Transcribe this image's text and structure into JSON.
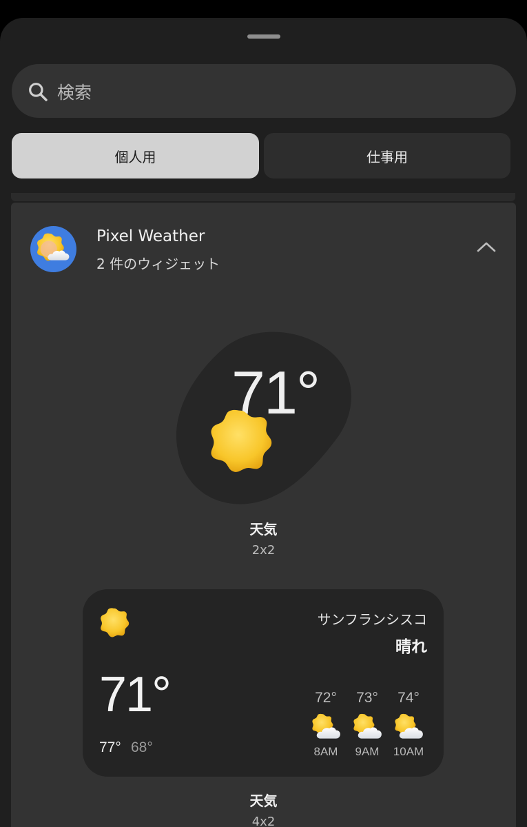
{
  "search": {
    "placeholder": "検索"
  },
  "tabs": [
    {
      "label": "個人用",
      "selected": true
    },
    {
      "label": "仕事用",
      "selected": false
    }
  ],
  "app": {
    "name": "Pixel Weather",
    "widget_count": "2 件のウィジェット",
    "icon": "weather-app-icon"
  },
  "widget_small": {
    "temperature": "71°",
    "label": "天気",
    "size": "2x2",
    "icon": "sun-icon"
  },
  "widget_large": {
    "city": "サンフランシスコ",
    "condition": "晴れ",
    "temperature": "71°",
    "high": "77°",
    "low": "68°",
    "label": "天気",
    "size": "4x2",
    "hourly": [
      {
        "temp": "72°",
        "time": "8AM",
        "icon": "partly-cloudy-icon"
      },
      {
        "temp": "73°",
        "time": "9AM",
        "icon": "partly-cloudy-icon"
      },
      {
        "temp": "74°",
        "time": "10AM",
        "icon": "partly-cloudy-icon"
      }
    ]
  },
  "colors": {
    "sun": "#f7c52b",
    "app_icon_bg": "#3f7de0",
    "selected_tab": "#d2d2d2"
  }
}
